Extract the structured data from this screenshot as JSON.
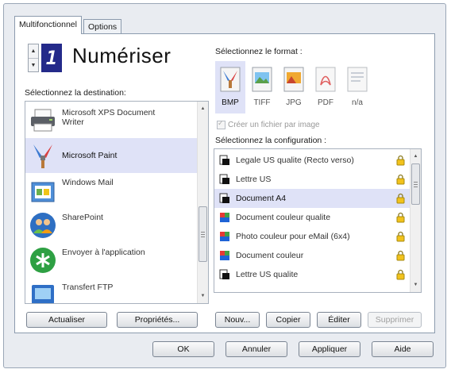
{
  "tabs": [
    {
      "label": "Multifonctionnel",
      "active": true
    },
    {
      "label": "Options",
      "active": false
    }
  ],
  "counter": "1",
  "scan_title": "Numériser",
  "destination": {
    "label": "Sélectionnez la destination:",
    "items": [
      {
        "label": "Microsoft XPS Document\nWriter",
        "icon": "printer-icon",
        "selected": false
      },
      {
        "label": "Microsoft Paint",
        "icon": "paint-brush-icon",
        "selected": true
      },
      {
        "label": "Windows Mail",
        "icon": "mail-icon",
        "selected": false
      },
      {
        "label": "SharePoint",
        "icon": "people-icon",
        "selected": false
      },
      {
        "label": "Envoyer à l'application",
        "icon": "send-app-icon",
        "selected": false
      },
      {
        "label": "Transfert FTP",
        "icon": "ftp-icon",
        "selected": false
      }
    ],
    "buttons": {
      "refresh": "Actualiser",
      "properties": "Propriétés..."
    }
  },
  "format": {
    "label": "Sélectionnez le format :",
    "items": [
      {
        "label": "BMP",
        "icon": "bmp-icon",
        "selected": true
      },
      {
        "label": "TIFF",
        "icon": "tiff-icon",
        "selected": false
      },
      {
        "label": "JPG",
        "icon": "jpg-icon",
        "selected": false
      },
      {
        "label": "PDF",
        "icon": "pdf-icon",
        "selected": false
      },
      {
        "label": "n/a",
        "icon": "text-format-icon",
        "selected": false
      }
    ],
    "checkbox_label": "Créer un fichier par image",
    "checkbox_checked": true
  },
  "configuration": {
    "label": "Sélectionnez la configuration :",
    "items": [
      {
        "label": "Legale US qualite (Recto verso)",
        "color": false,
        "selected": false
      },
      {
        "label": "Lettre US",
        "color": false,
        "selected": false
      },
      {
        "label": "Document A4",
        "color": false,
        "selected": true
      },
      {
        "label": "Document couleur qualite",
        "color": true,
        "selected": false
      },
      {
        "label": "Photo couleur pour eMail (6x4)",
        "color": true,
        "selected": false
      },
      {
        "label": "Document couleur",
        "color": true,
        "selected": false
      },
      {
        "label": "Lettre US qualite",
        "color": false,
        "selected": false
      }
    ],
    "buttons": {
      "new": "Nouv...",
      "copy": "Copier",
      "edit": "Éditer",
      "delete": "Supprimer"
    }
  },
  "footer": {
    "ok": "OK",
    "cancel": "Annuler",
    "apply": "Appliquer",
    "help": "Aide"
  },
  "colors": {
    "selection": "#dfe2f7",
    "counter_bg": "#242a8a",
    "frame": "#e9ecf1"
  }
}
